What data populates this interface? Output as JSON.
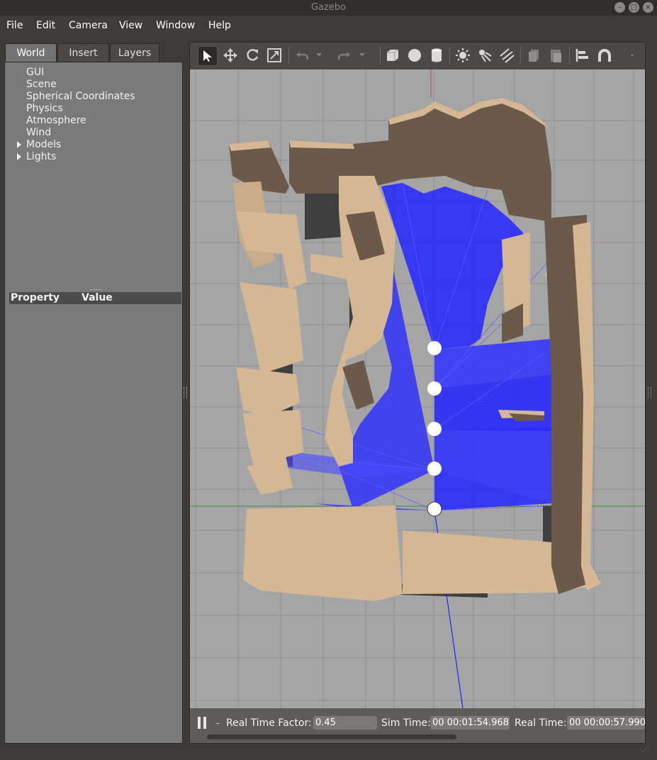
{
  "window": {
    "title": "Gazebo"
  },
  "menubar": {
    "items": [
      {
        "label": "File"
      },
      {
        "label": "Edit"
      },
      {
        "label": "Camera"
      },
      {
        "label": "View"
      },
      {
        "label": "Window"
      },
      {
        "label": "Help"
      }
    ]
  },
  "left_panel": {
    "tabs": [
      {
        "label": "World",
        "active": true
      },
      {
        "label": "Insert"
      },
      {
        "label": "Layers"
      }
    ],
    "tree": [
      {
        "label": "GUI"
      },
      {
        "label": "Scene"
      },
      {
        "label": "Spherical Coordinates"
      },
      {
        "label": "Physics"
      },
      {
        "label": "Atmosphere"
      },
      {
        "label": "Wind"
      },
      {
        "label": "Models",
        "expandable": true
      },
      {
        "label": "Lights",
        "expandable": true
      }
    ],
    "property_header": {
      "property": "Property",
      "value": "Value"
    }
  },
  "toolbar": {
    "icons": [
      "select-icon",
      "translate-icon",
      "rotate-icon",
      "scale-icon",
      "undo-icon",
      "undo-dropdown-icon",
      "redo-icon",
      "redo-dropdown-icon",
      "box-icon",
      "sphere-icon",
      "cylinder-icon",
      "point-light-icon",
      "spot-light-icon",
      "directional-light-icon",
      "copy-icon",
      "paste-icon",
      "align-icon",
      "snap-icon"
    ]
  },
  "statusbar": {
    "rtf_label": "Real Time Factor:",
    "rtf_value": "0.45",
    "sim_label": "Sim Time:",
    "sim_value": "00 00:01:54.968",
    "real_label": "Real Time:",
    "real_value": "00 00:00:57.990"
  },
  "colors": {
    "background": "#3c3b37",
    "ground": "#a5a5a5",
    "walls": "#d4b896",
    "wall_shadow": "#6b5a4a",
    "laser": "#1f1fff"
  }
}
